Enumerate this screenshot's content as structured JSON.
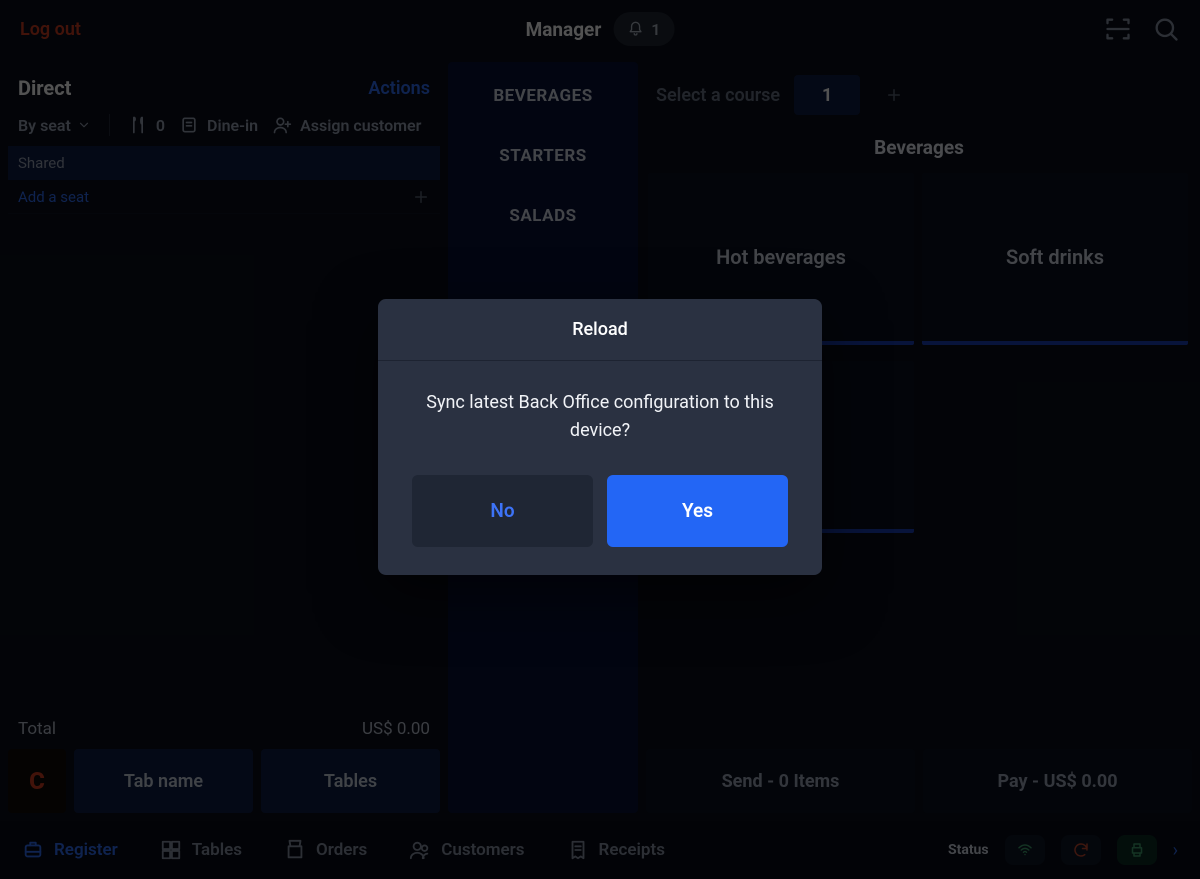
{
  "header": {
    "logout": "Log out",
    "role": "Manager",
    "notif_count": "1"
  },
  "left": {
    "title": "Direct",
    "actions": "Actions",
    "byseat": "By seat",
    "guest_count": "0",
    "dinein": "Dine-in",
    "assign": "Assign customer",
    "shared": "Shared",
    "add_seat": "Add a seat",
    "total_label": "Total",
    "total_value": "US$ 0.00",
    "c_button": "C",
    "tabname": "Tab name",
    "tables": "Tables"
  },
  "categories": [
    "BEVERAGES",
    "STARTERS",
    "SALADS"
  ],
  "right": {
    "course_label": "Select a course",
    "course_num": "1",
    "section": "Beverages",
    "tiles": [
      "Hot beverages",
      "Soft drinks",
      ""
    ],
    "send": "Send - 0 Items",
    "pay": "Pay - US$ 0.00"
  },
  "nav": {
    "register": "Register",
    "tables": "Tables",
    "orders": "Orders",
    "customers": "Customers",
    "receipts": "Receipts",
    "status": "Status"
  },
  "modal": {
    "title": "Reload",
    "message": "Sync latest Back Office configuration to this device?",
    "no": "No",
    "yes": "Yes"
  }
}
